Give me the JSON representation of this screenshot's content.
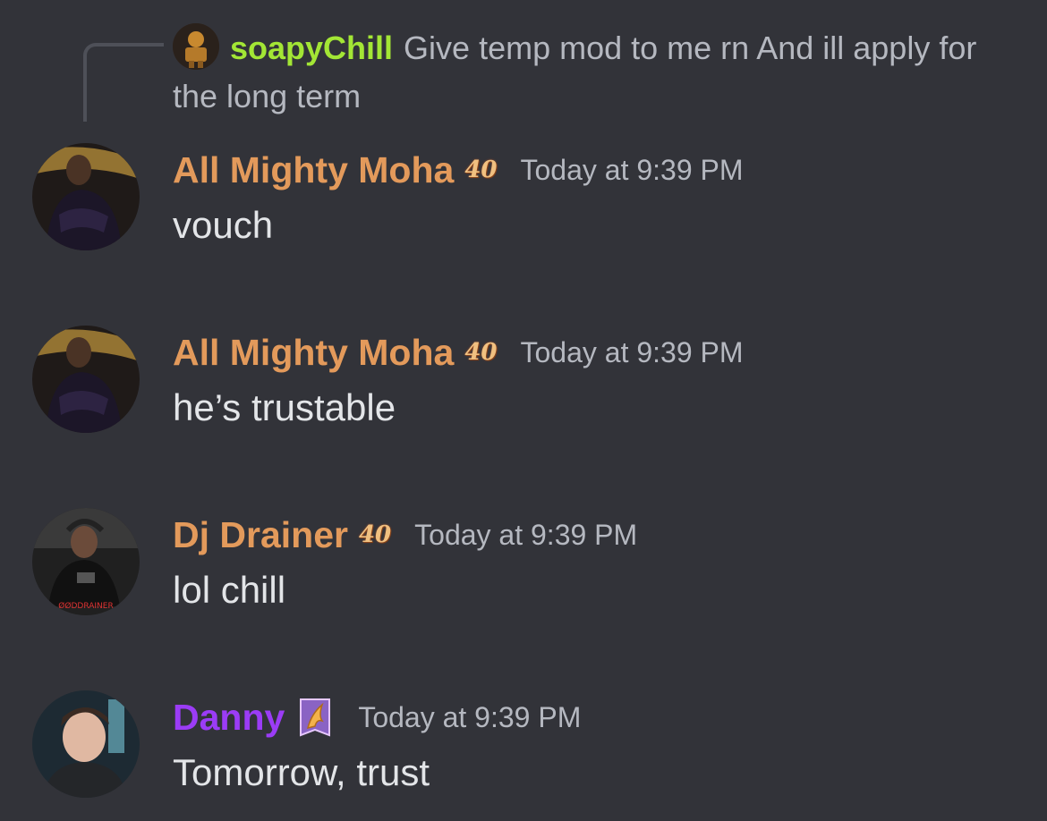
{
  "reply": {
    "username": "soapyChill",
    "text": "Give temp mod to me rn  And ill apply for the long term"
  },
  "messages": [
    {
      "username": "All Mighty Moha",
      "badge": "40",
      "timestamp": "Today at 9:39 PM",
      "content": "vouch",
      "color": "#e39a5b"
    },
    {
      "username": "All Mighty Moha",
      "badge": "40",
      "timestamp": "Today at 9:39 PM",
      "content": "he’s trustable",
      "color": "#e39a5b"
    },
    {
      "username": "Dj Drainer",
      "badge": "40",
      "timestamp": "Today at 9:39 PM",
      "content": "lol chill",
      "color": "#e39a5b",
      "avatar_text": "ØØDDRAINER"
    },
    {
      "username": "Danny",
      "timestamp": "Today at 9:39 PM",
      "content": "Tomorrow, trust",
      "color": "#9b3cf6"
    }
  ],
  "colors": {
    "background": "#323339",
    "reply_username": "#a3e635",
    "timestamp": "#b5b8c0",
    "message_text": "#e3e5e8"
  }
}
